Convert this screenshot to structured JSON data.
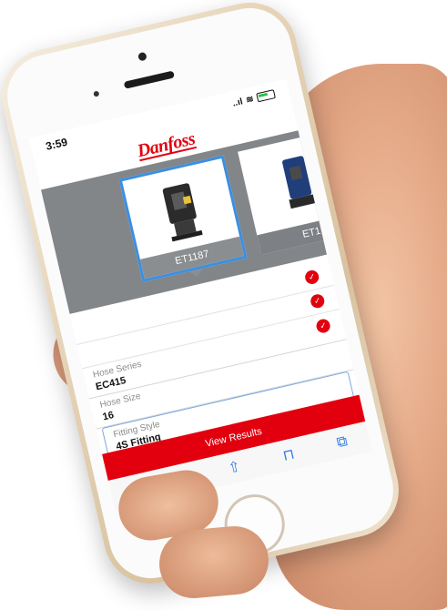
{
  "status": {
    "time": "3:59",
    "signal_glyph": "..ıl",
    "wifi_glyph": "≋"
  },
  "header": {
    "logo_text": "Danfoss"
  },
  "carousel": {
    "selected": {
      "label": "ET1187"
    },
    "next": {
      "label": "ET1"
    }
  },
  "form": {
    "fields": [
      {
        "label": "Hose Series",
        "value": "EC415"
      },
      {
        "label": "Hose Size",
        "value": "16"
      },
      {
        "label": "Fitting Style",
        "value": "4S Fitting"
      }
    ],
    "check_glyph": "✓"
  },
  "actions": {
    "view_results_label": "View Results"
  },
  "browser_toolbar": {
    "back_glyph": "‹",
    "forward_glyph": "›",
    "share_glyph": "⇧",
    "bookmarks_glyph": "⊓",
    "tabs_glyph": "⧉"
  },
  "colors": {
    "brand_red": "#e2000f",
    "selection_blue": "#3b8fe0",
    "carousel_gray": "#838689"
  }
}
